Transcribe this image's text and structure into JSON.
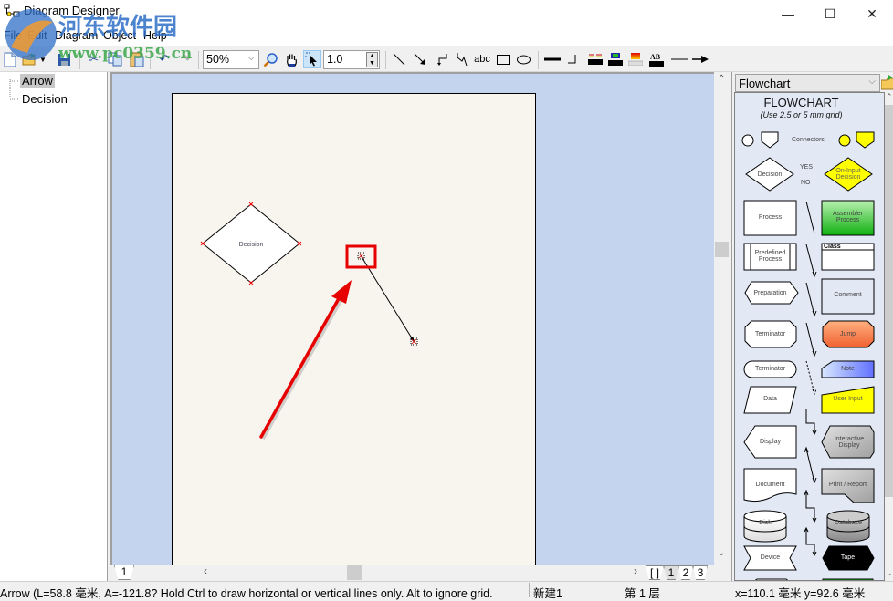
{
  "window": {
    "title": "Diagram Designer",
    "minimize": "—",
    "maximize": "☐",
    "close": "✕"
  },
  "watermark": {
    "name": "河东软件园",
    "url": "www.pc0359.cn"
  },
  "menu": {
    "items": [
      "File",
      "Edit",
      "Diagram",
      "Object",
      "Help"
    ]
  },
  "toolbar": {
    "zoom_value": "50%",
    "line_width_value": "1.0",
    "text_tool_label": "abc",
    "icons": [
      "new-icon",
      "open-icon",
      "save-icon",
      "cut-icon",
      "copy-icon",
      "paste-icon",
      "undo-icon",
      "redo-icon",
      "zoom-icon",
      "hand-icon",
      "select-icon",
      "line-icon",
      "arrow-line-icon",
      "elbow-line-icon",
      "curve-line-icon",
      "text-icon",
      "rectangle-icon",
      "ellipse-icon",
      "line-weight-icon",
      "corner-icon",
      "line-color-icon",
      "fill-color-icon",
      "gradient-icon",
      "font-icon",
      "line-end-none-icon",
      "line-end-arrow-icon"
    ]
  },
  "tree": {
    "items": [
      {
        "label": "Arrow",
        "selected": true
      },
      {
        "label": "Decision",
        "selected": false
      }
    ]
  },
  "canvas": {
    "page_shapes": [
      {
        "type": "decision",
        "label": "Decision"
      },
      {
        "type": "arrow",
        "selected": true
      }
    ],
    "annotation": "red-highlight-box-and-arrow"
  },
  "pages": {
    "left_tab": "1",
    "tabs": [
      "[ ]",
      "1",
      "2",
      "3"
    ],
    "active": "1"
  },
  "library": {
    "selected": "Flowchart",
    "heading": "FLOWCHART",
    "subheading": "(Use 2.5 or 5 mm grid)",
    "connectors_label": "Connectors",
    "yes_label": "YES",
    "no_label": "NO",
    "shapes_left": [
      "Decision",
      "Process",
      "Predefined Process",
      "Preparation",
      "Terminator",
      "Terminator",
      "Data",
      "Display",
      "Document",
      "Disk",
      "Device"
    ],
    "shapes_right": [
      "On-Input Decision",
      "Assembler Process",
      "Class",
      "Comment",
      "Jump",
      "Note",
      "User Input",
      "Interactive Display",
      "Print / Report",
      "Database",
      "Tape"
    ]
  },
  "colors": {
    "canvas_bg": "#c5d4ee",
    "page_bg": "#f8f5ef",
    "library_bg": "#e2e9f5",
    "annotation_red": "#e60000",
    "assembler_green": "#22bb22",
    "jump_orange": "#f07040",
    "note_blue": "#8090ff",
    "user_input_yellow": "#ffff00",
    "tape_black": "#000000"
  },
  "status": {
    "hint": "Arrow (L=58.8 毫米, A=-121.8?  Hold Ctrl to draw horizontal or vertical lines only. Alt to ignore grid.",
    "document": "新建1",
    "layer": "第 1 层",
    "coords": "x=110.1 毫米  y=92.6 毫米"
  }
}
